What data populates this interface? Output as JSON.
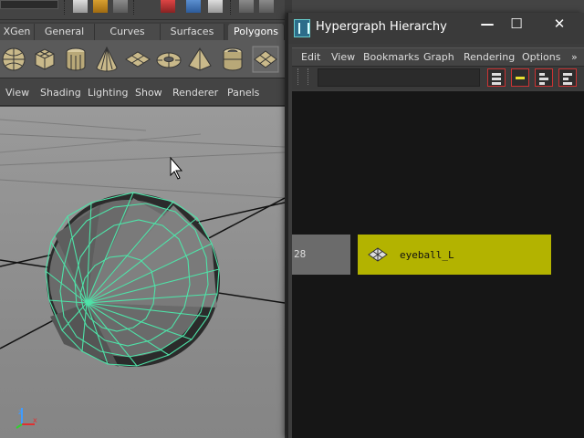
{
  "shelf": {
    "tabs": [
      {
        "label": "XGen"
      },
      {
        "label": "General"
      },
      {
        "label": "Curves"
      },
      {
        "label": "Surfaces"
      },
      {
        "label": "Polygons"
      }
    ],
    "icons": [
      "sphere-icon",
      "cube-icon",
      "cylinder-icon",
      "cone-icon",
      "plane-icon",
      "torus-icon",
      "pyramid-icon",
      "pipe-icon",
      "combine-icon"
    ]
  },
  "panel_menu": {
    "items": [
      "View",
      "Shading",
      "Lighting",
      "Show",
      "Renderer",
      "Panels"
    ]
  },
  "viewport": {
    "object": "sphere",
    "wireframe_color": "#4ee3a8",
    "axis_icon": "axis-gizmo-icon"
  },
  "hypergraph": {
    "title": "Hypergraph Hierarchy",
    "window_buttons": {
      "minimize": "—",
      "maximize": "☐",
      "close": "✕"
    },
    "menu": [
      "Edit",
      "View",
      "Bookmarks",
      "Graph",
      "Rendering",
      "Options"
    ],
    "overflow": "»",
    "search": {
      "placeholder": ""
    },
    "nodes": {
      "partial": {
        "label": "28"
      },
      "selected": {
        "label": "eyeball_L",
        "color": "#b3b300"
      }
    }
  }
}
